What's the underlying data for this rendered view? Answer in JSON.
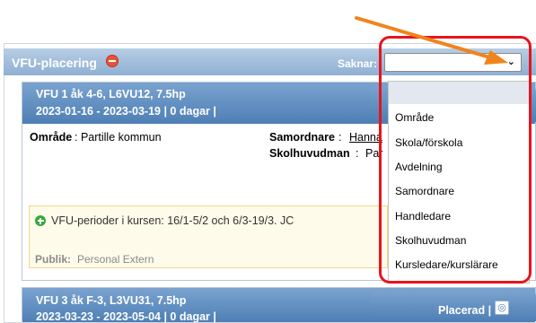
{
  "panel": {
    "title": "VFU-placering",
    "missing_label": "Saknar:",
    "missing_value": ""
  },
  "dropdown": {
    "options": [
      "Område",
      "Skola/förskola",
      "Avdelning",
      "Samordnare",
      "Handledare",
      "Skolhuvudman",
      "Kursledare/kurslärare"
    ]
  },
  "card1": {
    "title": "VFU 1 åk 4-6, L6VU12, 7.5hp",
    "dates": "2023-01-16 - 2023-03-19 | 0 dagar |",
    "area_label": "Område",
    "area_value": ": Partille kommun",
    "coordinator_label": "Samordnare",
    "coordinator_sep": ":",
    "coordinator_value": "Hanna",
    "principal_label": "Skolhuvudman",
    "principal_sep": ":",
    "principal_value": "Par",
    "note": "VFU-perioder i kursen: 16/1-5/2 och 6/3-19/3. JC",
    "publish_label": "Publik:",
    "publish_value": "Personal Extern"
  },
  "card2": {
    "title": "VFU 3 åk F-3, L3VU31, 7.5hp",
    "dates": "2023-03-23 - 2023-05-04 | 0 dagar |",
    "status": "Placerad |"
  },
  "colors": {
    "accent": "#4e7fb5",
    "highlight": "#e8141c",
    "arrow": "#f0841c"
  }
}
